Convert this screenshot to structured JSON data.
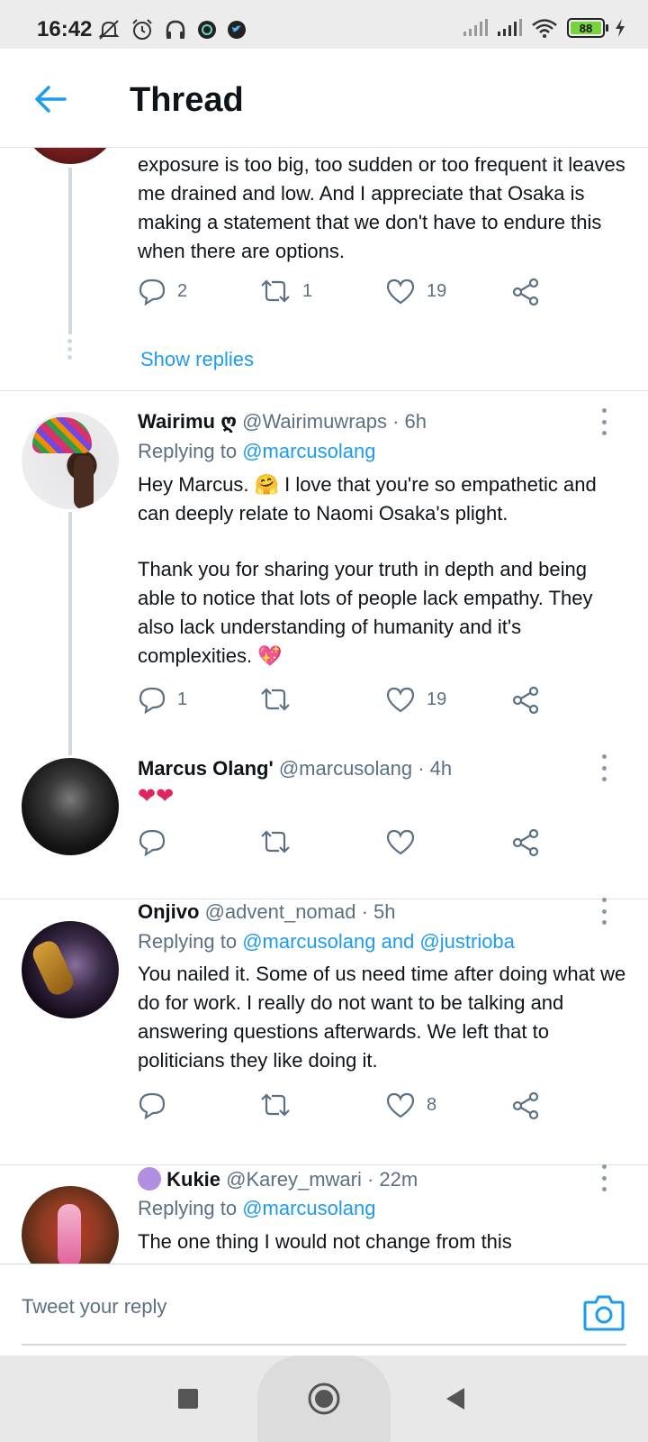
{
  "status_bar": {
    "time": "16:42",
    "battery": "88"
  },
  "header": {
    "title": "Thread"
  },
  "thread": {
    "first_tweet": {
      "text": "exposure is too big, too sudden or too frequent it leaves me drained and low. And I appreciate that Osaka is making a statement that we don't have to endure this when there are options.",
      "replies": "2",
      "retweets": "1",
      "likes": "19",
      "show_replies": "Show replies"
    },
    "tweets": [
      {
        "name": "Wairimu ღ",
        "handle": "@Wairimuwraps · 6h",
        "replying_prefix": "Replying to",
        "mentions": "@marcusolang",
        "text1": "Hey Marcus. 🤗 I love that you're so empathetic and can deeply relate to Naomi Osaka's plight.",
        "text2": "Thank you for sharing your truth in depth and being able to notice that lots of people lack empathy. They also lack understanding of humanity and it's complexities. 💖",
        "replies": "1",
        "retweets": "",
        "likes": "19"
      },
      {
        "name": "Marcus Olang'",
        "handle": "@marcusolang · 4h",
        "text1": "❤❤",
        "replies": "",
        "retweets": "",
        "likes": ""
      },
      {
        "name": "Onjivo",
        "handle": "@advent_nomad · 5h",
        "replying_prefix": "Replying to",
        "mentions": "@marcusolang and @justrioba",
        "text1": "You nailed it. Some of us need time after doing what we do for work. I really do not want to be talking and answering questions afterwards. We left that to politicians they like doing it.",
        "replies": "",
        "retweets": "",
        "likes": "8"
      },
      {
        "name": "Kukie",
        "handle": "@Karey_mwari · 22m",
        "replying_prefix": "Replying to",
        "mentions": "@marcusolang",
        "text1": "The one thing I would not change from this"
      }
    ]
  },
  "reply_bar": {
    "placeholder": "Tweet your reply"
  },
  "colors": {
    "accent": "#1d9bf0",
    "secondary_text": "#5b7083"
  }
}
